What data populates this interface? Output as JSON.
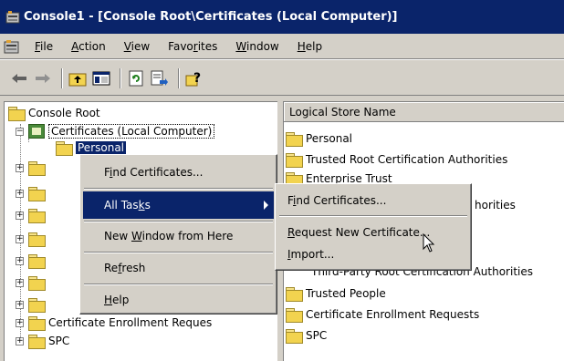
{
  "window": {
    "title": "Console1 - [Console Root\\Certificates (Local Computer)]",
    "title_color": "#0a246a"
  },
  "menubar": {
    "items": [
      {
        "label": "File",
        "mnemonic_index": 0
      },
      {
        "label": "Action",
        "mnemonic_index": 0
      },
      {
        "label": "View",
        "mnemonic_index": 0
      },
      {
        "label": "Favorites",
        "mnemonic_index": 4
      },
      {
        "label": "Window",
        "mnemonic_index": 0
      },
      {
        "label": "Help",
        "mnemonic_index": 0
      }
    ]
  },
  "toolbar": {
    "back_icon": "back-arrow-icon",
    "forward_icon": "forward-arrow-icon",
    "up_icon": "up-folder-icon",
    "show_hide_tree_icon": "show-hide-tree-icon",
    "refresh_icon": "refresh-icon",
    "export_icon": "export-list-icon",
    "help_icon": "help-icon"
  },
  "tree": {
    "root": "Console Root",
    "snapin": "Certificates (Local Computer)",
    "selected": "Personal",
    "partial_item": "Certificate Enrollment Reques",
    "last_item": "SPC"
  },
  "list": {
    "column_header": "Logical Store Name",
    "items": [
      "Personal",
      "Trusted Root Certification Authorities",
      "Enterprise Trust",
      "horities",
      "Third-Party Root Certification Authorities",
      "Trusted People",
      "Certificate Enrollment Requests",
      "SPC"
    ]
  },
  "context_menu": {
    "items": [
      {
        "label": "Find Certificates...",
        "mn": 1
      },
      {
        "label": "All Tasks",
        "mn": 7
      },
      {
        "label": "New Window from Here",
        "mn": 4
      },
      {
        "label": "Refresh",
        "mn": 2
      },
      {
        "label": "Help",
        "mn": 0
      }
    ]
  },
  "submenu": {
    "items": [
      {
        "label": "Find Certificates...",
        "mn": 1
      },
      {
        "label": "Request New Certificate...",
        "mn": 0
      },
      {
        "label": "Import...",
        "mn": 0
      }
    ]
  },
  "colors": {
    "highlight": "#0a246a",
    "face": "#d4d0c8",
    "folder": "#f2d34f"
  }
}
